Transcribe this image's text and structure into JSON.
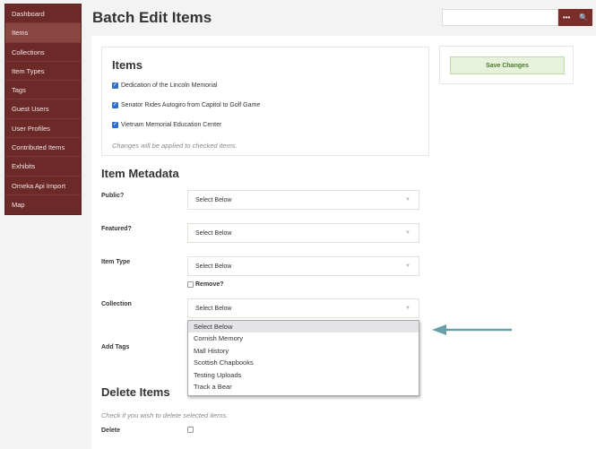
{
  "sidebar": {
    "items": [
      {
        "label": "Dashboard"
      },
      {
        "label": "Items"
      },
      {
        "label": "Collections"
      },
      {
        "label": "Item Types"
      },
      {
        "label": "Tags"
      },
      {
        "label": "Guest Users"
      },
      {
        "label": "User Profiles"
      },
      {
        "label": "Contributed Items"
      },
      {
        "label": "Exhibits"
      },
      {
        "label": "Omeka Api Import"
      },
      {
        "label": "Map"
      }
    ],
    "active": "Items"
  },
  "header": {
    "title": "Batch Edit Items",
    "search_value": "",
    "advanced_icon": "ellipsis-icon",
    "search_icon": "search-icon"
  },
  "items_box": {
    "title": "Items",
    "items": [
      {
        "label": "Dedication of the Lincoln Memorial",
        "checked": true
      },
      {
        "label": "Senator Rides Autogiro from Capitol to Golf Game",
        "checked": true
      },
      {
        "label": "Vietnam Memorial Education Center",
        "checked": true
      }
    ],
    "note": "Changes will be applied to checked items."
  },
  "save": {
    "label": "Save Changes"
  },
  "metadata": {
    "title": "Item Metadata",
    "public": {
      "label": "Public?",
      "value": "Select Below"
    },
    "featured": {
      "label": "Featured?",
      "value": "Select Below"
    },
    "item_type": {
      "label": "Item Type",
      "value": "Select Below",
      "remove_label": "Remove?"
    },
    "collection": {
      "label": "Collection",
      "value": "Select Below",
      "options": [
        "Select Below",
        "Cornish Memory",
        "Mall History",
        "Scottish Chapbooks",
        "Testing Uploads",
        "Track a Bear"
      ],
      "highlighted": "Select Below"
    },
    "tags": {
      "label": "Add Tags"
    }
  },
  "delete": {
    "title": "Delete Items",
    "note": "Check if you wish to delete selected items.",
    "label": "Delete",
    "checked": false
  },
  "colors": {
    "sidebar": "#6b2a28",
    "accent": "#7b2d2a",
    "save_bg": "#e6f2dc",
    "arrow": "#6a9fa8"
  }
}
